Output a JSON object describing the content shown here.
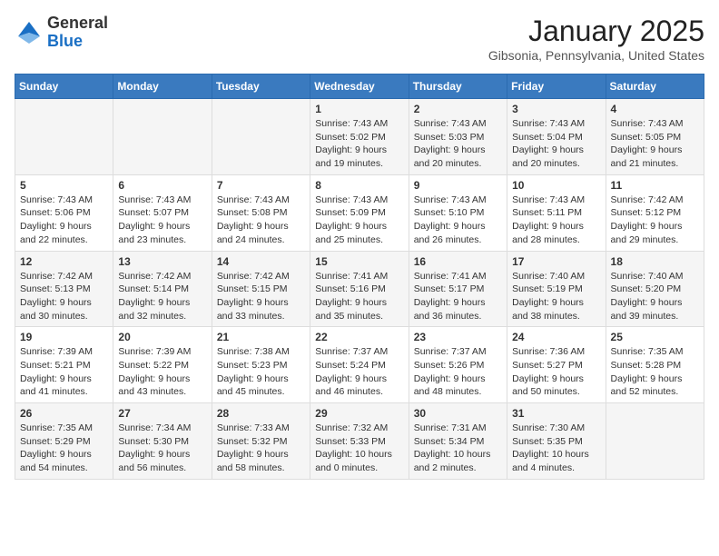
{
  "logo": {
    "general": "General",
    "blue": "Blue"
  },
  "header": {
    "month": "January 2025",
    "location": "Gibsonia, Pennsylvania, United States"
  },
  "weekdays": [
    "Sunday",
    "Monday",
    "Tuesday",
    "Wednesday",
    "Thursday",
    "Friday",
    "Saturday"
  ],
  "weeks": [
    [
      {
        "day": "",
        "sunrise": "",
        "sunset": "",
        "daylight": ""
      },
      {
        "day": "",
        "sunrise": "",
        "sunset": "",
        "daylight": ""
      },
      {
        "day": "",
        "sunrise": "",
        "sunset": "",
        "daylight": ""
      },
      {
        "day": "1",
        "sunrise": "Sunrise: 7:43 AM",
        "sunset": "Sunset: 5:02 PM",
        "daylight": "Daylight: 9 hours and 19 minutes."
      },
      {
        "day": "2",
        "sunrise": "Sunrise: 7:43 AM",
        "sunset": "Sunset: 5:03 PM",
        "daylight": "Daylight: 9 hours and 20 minutes."
      },
      {
        "day": "3",
        "sunrise": "Sunrise: 7:43 AM",
        "sunset": "Sunset: 5:04 PM",
        "daylight": "Daylight: 9 hours and 20 minutes."
      },
      {
        "day": "4",
        "sunrise": "Sunrise: 7:43 AM",
        "sunset": "Sunset: 5:05 PM",
        "daylight": "Daylight: 9 hours and 21 minutes."
      }
    ],
    [
      {
        "day": "5",
        "sunrise": "Sunrise: 7:43 AM",
        "sunset": "Sunset: 5:06 PM",
        "daylight": "Daylight: 9 hours and 22 minutes."
      },
      {
        "day": "6",
        "sunrise": "Sunrise: 7:43 AM",
        "sunset": "Sunset: 5:07 PM",
        "daylight": "Daylight: 9 hours and 23 minutes."
      },
      {
        "day": "7",
        "sunrise": "Sunrise: 7:43 AM",
        "sunset": "Sunset: 5:08 PM",
        "daylight": "Daylight: 9 hours and 24 minutes."
      },
      {
        "day": "8",
        "sunrise": "Sunrise: 7:43 AM",
        "sunset": "Sunset: 5:09 PM",
        "daylight": "Daylight: 9 hours and 25 minutes."
      },
      {
        "day": "9",
        "sunrise": "Sunrise: 7:43 AM",
        "sunset": "Sunset: 5:10 PM",
        "daylight": "Daylight: 9 hours and 26 minutes."
      },
      {
        "day": "10",
        "sunrise": "Sunrise: 7:43 AM",
        "sunset": "Sunset: 5:11 PM",
        "daylight": "Daylight: 9 hours and 28 minutes."
      },
      {
        "day": "11",
        "sunrise": "Sunrise: 7:42 AM",
        "sunset": "Sunset: 5:12 PM",
        "daylight": "Daylight: 9 hours and 29 minutes."
      }
    ],
    [
      {
        "day": "12",
        "sunrise": "Sunrise: 7:42 AM",
        "sunset": "Sunset: 5:13 PM",
        "daylight": "Daylight: 9 hours and 30 minutes."
      },
      {
        "day": "13",
        "sunrise": "Sunrise: 7:42 AM",
        "sunset": "Sunset: 5:14 PM",
        "daylight": "Daylight: 9 hours and 32 minutes."
      },
      {
        "day": "14",
        "sunrise": "Sunrise: 7:42 AM",
        "sunset": "Sunset: 5:15 PM",
        "daylight": "Daylight: 9 hours and 33 minutes."
      },
      {
        "day": "15",
        "sunrise": "Sunrise: 7:41 AM",
        "sunset": "Sunset: 5:16 PM",
        "daylight": "Daylight: 9 hours and 35 minutes."
      },
      {
        "day": "16",
        "sunrise": "Sunrise: 7:41 AM",
        "sunset": "Sunset: 5:17 PM",
        "daylight": "Daylight: 9 hours and 36 minutes."
      },
      {
        "day": "17",
        "sunrise": "Sunrise: 7:40 AM",
        "sunset": "Sunset: 5:19 PM",
        "daylight": "Daylight: 9 hours and 38 minutes."
      },
      {
        "day": "18",
        "sunrise": "Sunrise: 7:40 AM",
        "sunset": "Sunset: 5:20 PM",
        "daylight": "Daylight: 9 hours and 39 minutes."
      }
    ],
    [
      {
        "day": "19",
        "sunrise": "Sunrise: 7:39 AM",
        "sunset": "Sunset: 5:21 PM",
        "daylight": "Daylight: 9 hours and 41 minutes."
      },
      {
        "day": "20",
        "sunrise": "Sunrise: 7:39 AM",
        "sunset": "Sunset: 5:22 PM",
        "daylight": "Daylight: 9 hours and 43 minutes."
      },
      {
        "day": "21",
        "sunrise": "Sunrise: 7:38 AM",
        "sunset": "Sunset: 5:23 PM",
        "daylight": "Daylight: 9 hours and 45 minutes."
      },
      {
        "day": "22",
        "sunrise": "Sunrise: 7:37 AM",
        "sunset": "Sunset: 5:24 PM",
        "daylight": "Daylight: 9 hours and 46 minutes."
      },
      {
        "day": "23",
        "sunrise": "Sunrise: 7:37 AM",
        "sunset": "Sunset: 5:26 PM",
        "daylight": "Daylight: 9 hours and 48 minutes."
      },
      {
        "day": "24",
        "sunrise": "Sunrise: 7:36 AM",
        "sunset": "Sunset: 5:27 PM",
        "daylight": "Daylight: 9 hours and 50 minutes."
      },
      {
        "day": "25",
        "sunrise": "Sunrise: 7:35 AM",
        "sunset": "Sunset: 5:28 PM",
        "daylight": "Daylight: 9 hours and 52 minutes."
      }
    ],
    [
      {
        "day": "26",
        "sunrise": "Sunrise: 7:35 AM",
        "sunset": "Sunset: 5:29 PM",
        "daylight": "Daylight: 9 hours and 54 minutes."
      },
      {
        "day": "27",
        "sunrise": "Sunrise: 7:34 AM",
        "sunset": "Sunset: 5:30 PM",
        "daylight": "Daylight: 9 hours and 56 minutes."
      },
      {
        "day": "28",
        "sunrise": "Sunrise: 7:33 AM",
        "sunset": "Sunset: 5:32 PM",
        "daylight": "Daylight: 9 hours and 58 minutes."
      },
      {
        "day": "29",
        "sunrise": "Sunrise: 7:32 AM",
        "sunset": "Sunset: 5:33 PM",
        "daylight": "Daylight: 10 hours and 0 minutes."
      },
      {
        "day": "30",
        "sunrise": "Sunrise: 7:31 AM",
        "sunset": "Sunset: 5:34 PM",
        "daylight": "Daylight: 10 hours and 2 minutes."
      },
      {
        "day": "31",
        "sunrise": "Sunrise: 7:30 AM",
        "sunset": "Sunset: 5:35 PM",
        "daylight": "Daylight: 10 hours and 4 minutes."
      },
      {
        "day": "",
        "sunrise": "",
        "sunset": "",
        "daylight": ""
      }
    ]
  ]
}
